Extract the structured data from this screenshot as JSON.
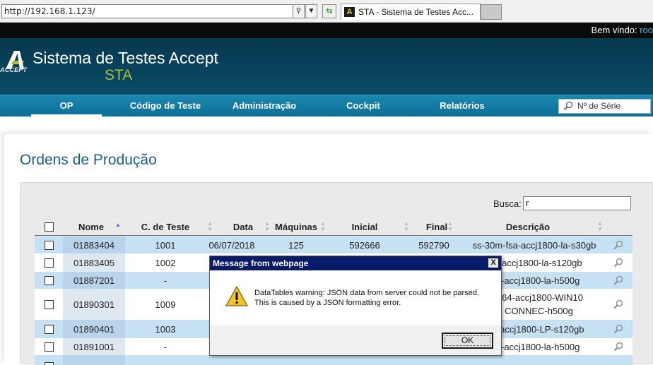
{
  "browser": {
    "address": "http://192.168.1.123/",
    "tab_title": "STA - Sistema de Testes Acc...",
    "tab_icon_glyph": "A"
  },
  "topbar": {
    "welcome": "Bem vindo:",
    "user": "roo"
  },
  "header": {
    "logo_text": "ACCEPT",
    "title": "Sistema de Testes Accept",
    "subtitle": "STA"
  },
  "nav": {
    "items": [
      "OP",
      "Código de Teste",
      "Administração",
      "Cockpit",
      "Relatórios"
    ],
    "search_placeholder": "Nº de Série"
  },
  "page": {
    "title": "Ordens de Produção"
  },
  "table": {
    "search_label": "Busca:",
    "search_value": "r",
    "columns": [
      "Nome",
      "C. de Teste",
      "Data",
      "Máquinas",
      "Inicial",
      "Final",
      "Descrição"
    ],
    "rows": [
      {
        "nome": "01883404",
        "teste": "1001",
        "data": "06/07/2018",
        "maquinas": "125",
        "inicial": "592666",
        "final": "592790",
        "descricao": "ss-30m-fsa-accj1800-la-s30gb"
      },
      {
        "nome": "01883405",
        "teste": "1002",
        "data": "",
        "maquinas": "",
        "inicial": "",
        "final": "",
        "descricao": "fsa-accj1800-la-s120gb"
      },
      {
        "nome": "01887201",
        "teste": "-",
        "data": "",
        "maquinas": "",
        "inicial": "",
        "final": "",
        "descricao": "fsa-accj1800-la-h500g"
      },
      {
        "nome": "01890301",
        "teste": "1009",
        "data": "",
        "maquinas": "",
        "inicial": "",
        "final": "",
        "descricao": "ISM64-accj1800-WIN10",
        "descricao2": "D CONNEC-h500g"
      },
      {
        "nome": "01890401",
        "teste": "1003",
        "data": "",
        "maquinas": "",
        "inicial": "",
        "final": "",
        "descricao": "fsa-accj1800-LP-s120gb"
      },
      {
        "nome": "01891001",
        "teste": "-",
        "data": "",
        "maquinas": "",
        "inicial": "",
        "final": "",
        "descricao": "fsa-accj1800-la-h500g"
      }
    ]
  },
  "dialog": {
    "title": "Message from webpage",
    "line1": "DataTables warning: JSON data from server could not be parsed.",
    "line2": "This is caused by a JSON formatting error.",
    "ok": "OK",
    "close_glyph": "X"
  },
  "colors": {
    "header_bg": "#0a4b66",
    "nav_bg": "#1a87b0",
    "accent_green": "#a9c23c",
    "row_alt": "#c7e1f4",
    "dialog_title_bg": "#081a6a"
  }
}
